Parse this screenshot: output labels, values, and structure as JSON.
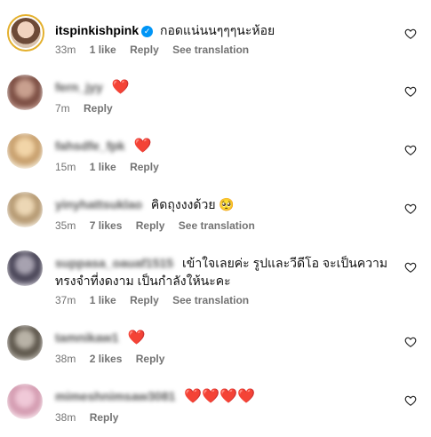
{
  "comments": [
    {
      "username": "itspinkishpink",
      "verified": true,
      "text": "กอดแน่นนๆๆๆนะห้อย",
      "time": "33m",
      "likes": "1 like",
      "reply": "Reply",
      "translation": "See translation"
    },
    {
      "username": "fern_jyy",
      "text": "❤️",
      "time": "7m",
      "reply": "Reply"
    },
    {
      "username": "fahsdfe_fpk",
      "text": "❤️",
      "time": "15m",
      "likes": "1 like",
      "reply": "Reply"
    },
    {
      "username": "yinyhattsuklao",
      "text": "คิดถุงงงด้วย 🥺",
      "time": "35m",
      "likes": "7 likes",
      "reply": "Reply",
      "translation": "See translation"
    },
    {
      "username": "suppasa_oauaf1515",
      "text": "เข้าใจเลยค่ะ รูปและวีดีโอ จะเป็นความทรงจำที่งดงาม เป็นกำลังให้นะคะ",
      "time": "37m",
      "likes": "1 like",
      "reply": "Reply",
      "translation": "See translation"
    },
    {
      "username": "tamnikaw1",
      "text": "❤️",
      "time": "38m",
      "likes": "2 likes",
      "reply": "Reply"
    },
    {
      "username": "mimeshnimsaw3081",
      "text": "❤️❤️❤️❤️",
      "time": "38m",
      "reply": "Reply"
    }
  ]
}
